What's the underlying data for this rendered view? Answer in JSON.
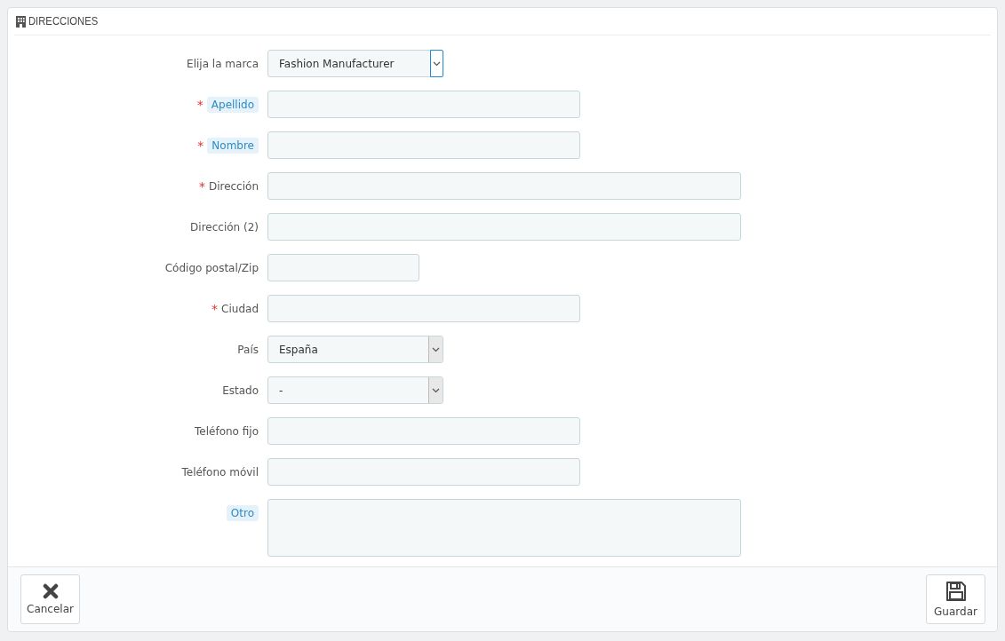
{
  "panel": {
    "title": "DIRECCIONES"
  },
  "fields": [
    {
      "label": "Elija la marca",
      "kind": "select",
      "value": "Fashion Manufacturer",
      "hint": false,
      "focused": true
    },
    {
      "required_mark": "*",
      "label": "Apellido",
      "kind": "text",
      "hint": true
    },
    {
      "required_mark": "*",
      "label": "Nombre",
      "kind": "text",
      "hint": true
    },
    {
      "required_mark": "*",
      "label": "Dirección",
      "kind": "text",
      "hint": false
    },
    {
      "label": "Dirección (2)",
      "kind": "text",
      "hint": false
    },
    {
      "label": "Código postal/Zip",
      "kind": "text",
      "hint": false
    },
    {
      "required_mark": "*",
      "label": "Ciudad",
      "kind": "text",
      "hint": false
    },
    {
      "label": "País",
      "kind": "select",
      "value": "España",
      "hint": false,
      "focused": false
    },
    {
      "label": "Estado",
      "kind": "select",
      "value": "-",
      "hint": false,
      "focused": false
    },
    {
      "label": "Teléfono fijo",
      "kind": "text",
      "hint": false
    },
    {
      "label": "Teléfono móvil",
      "kind": "text",
      "hint": false
    },
    {
      "label": "Otro",
      "kind": "textarea",
      "hint": true
    }
  ],
  "buttons": [
    {
      "label": "Cancelar",
      "kind": "cancel"
    },
    {
      "label": "Guardar",
      "kind": "save"
    }
  ]
}
